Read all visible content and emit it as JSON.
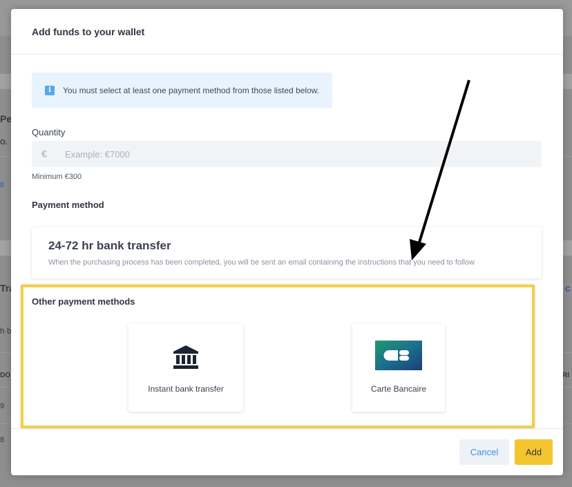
{
  "background": {
    "fragments": [
      "Per",
      "O.",
      "8",
      "Tra",
      "h b",
      "DO",
      "9",
      "8",
      "c",
      "RI"
    ]
  },
  "modal": {
    "title": "Add funds to your wallet",
    "info": {
      "icon": "info-icon",
      "icon_glyph": "i",
      "text": "You must select at least one payment method from those listed below."
    },
    "quantity": {
      "label": "Quantity",
      "currency_symbol": "€",
      "value": "",
      "placeholder": "Example: €7000",
      "hint": "Minimum €300"
    },
    "payment_method": {
      "label": "Payment method",
      "bank_transfer": {
        "title": "24-72 hr bank transfer",
        "description": "When the purchasing process has been completed, you will be sent an email containing the instructions that you need to follow"
      }
    },
    "other_methods": {
      "label": "Other payment methods",
      "items": [
        {
          "label": "Instant bank transfer",
          "icon": "bank-icon"
        },
        {
          "label": "Carte Bancaire",
          "icon": "cb-logo",
          "logo_text": "CB"
        }
      ]
    },
    "footer": {
      "cancel_label": "Cancel",
      "add_label": "Add"
    }
  },
  "colors": {
    "accent": "#3b8fdd",
    "primary_button": "#f5c530",
    "highlight_border": "#f2cf48",
    "info_bg": "#e8f3fd"
  }
}
